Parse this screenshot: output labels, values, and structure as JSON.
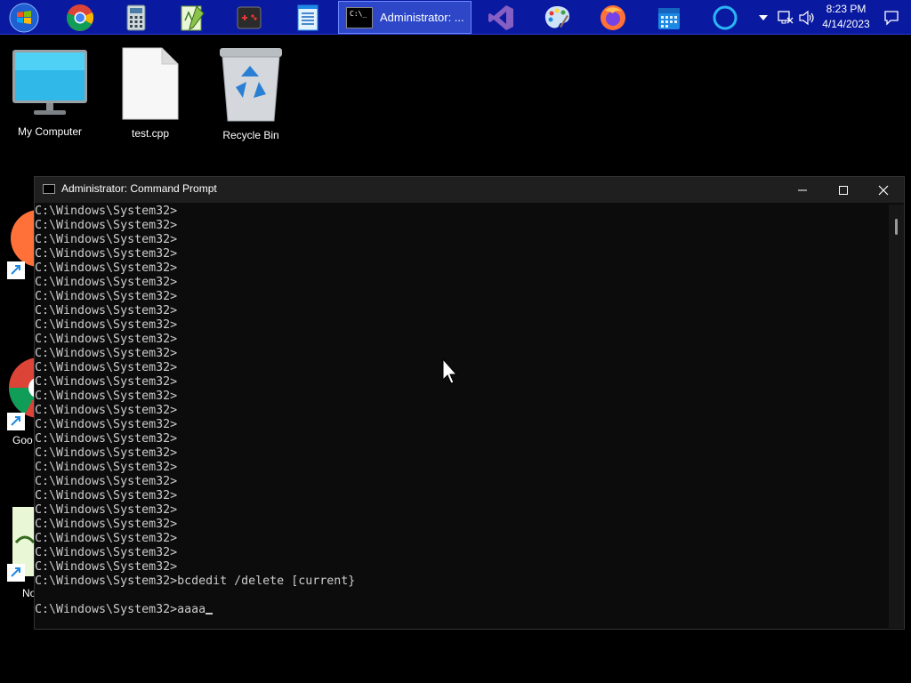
{
  "taskbar": {
    "pinned": [
      {
        "name": "start-orb-icon"
      },
      {
        "name": "chrome-icon"
      },
      {
        "name": "calculator-icon"
      },
      {
        "name": "notepadpp-icon"
      },
      {
        "name": "game-controller-icon"
      },
      {
        "name": "notepad-icon"
      },
      {
        "name": "visual-studio-icon"
      },
      {
        "name": "paint-icon"
      },
      {
        "name": "firefox-icon"
      },
      {
        "name": "calendar-icon"
      },
      {
        "name": "cortana-icon"
      }
    ],
    "active_window_label": "Administrator: ...",
    "active_window_icon_text": "C:\\_",
    "clock": {
      "time": "8:23 PM",
      "date": "4/14/2023"
    }
  },
  "desktop": {
    "icons": [
      {
        "label": "My Computer"
      },
      {
        "label": "test.cpp"
      },
      {
        "label": "Recycle Bin"
      }
    ],
    "partial_labels": {
      "google": "Goo",
      "notepad": "Noto"
    }
  },
  "cmd": {
    "title": "Administrator:  Command Prompt",
    "lines": [
      "C:\\Windows\\System32>",
      "C:\\Windows\\System32>",
      "C:\\Windows\\System32>",
      "C:\\Windows\\System32>",
      "C:\\Windows\\System32>",
      "C:\\Windows\\System32>",
      "C:\\Windows\\System32>",
      "C:\\Windows\\System32>",
      "C:\\Windows\\System32>",
      "C:\\Windows\\System32>",
      "C:\\Windows\\System32>",
      "C:\\Windows\\System32>",
      "C:\\Windows\\System32>",
      "C:\\Windows\\System32>",
      "C:\\Windows\\System32>",
      "C:\\Windows\\System32>",
      "C:\\Windows\\System32>",
      "C:\\Windows\\System32>",
      "C:\\Windows\\System32>",
      "C:\\Windows\\System32>",
      "C:\\Windows\\System32>",
      "C:\\Windows\\System32>",
      "C:\\Windows\\System32>",
      "C:\\Windows\\System32>",
      "C:\\Windows\\System32>",
      "C:\\Windows\\System32>",
      "C:\\Windows\\System32>bcdedit /delete [current}",
      "",
      "C:\\Windows\\System32>aaaa"
    ]
  }
}
